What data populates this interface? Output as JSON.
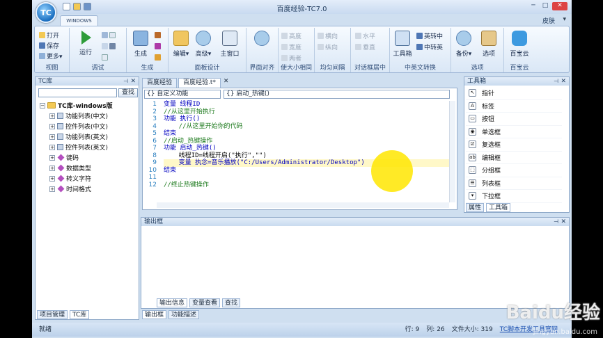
{
  "window": {
    "title": "百度经验-TC7.0",
    "skin_label": "皮肤",
    "skin_arrow": "▾"
  },
  "ribbon": {
    "tab": "WINDOWS",
    "groups": {
      "view": {
        "label": "视图",
        "open": "打开",
        "save": "保存",
        "more": "更多"
      },
      "debug": {
        "label": "调试",
        "run": "运行"
      },
      "build": {
        "label": "生成",
        "build": "生成"
      },
      "panel": {
        "label": "面板设计",
        "edit": "编辑",
        "advanced": "高级",
        "main_window": "主窗口"
      },
      "ui_align": {
        "label": "界面对齐",
        "button": "界面对齐"
      },
      "size": {
        "label": "使大小相同",
        "height": "高度",
        "width": "宽度",
        "both": "两者"
      },
      "spacing": {
        "label": "均匀间隔",
        "horizontal": "横向",
        "vertical": "纵向"
      },
      "center": {
        "label": "对话框居中",
        "horizontal": "水平",
        "vertical": "垂直"
      },
      "cn_en": {
        "label": "中英文转换",
        "toolbox": "工具箱",
        "en_to_cn": "英转中",
        "cn_to_en": "中转英"
      },
      "options": {
        "label": "选项",
        "backup": "备份",
        "options": "选项"
      },
      "baidu": {
        "label": "百宝云",
        "button": "百宝云"
      }
    }
  },
  "left_panel": {
    "title": "TC库",
    "search_button": "查找",
    "tree": [
      {
        "label": "TC库-windows版",
        "kind": "root"
      },
      {
        "label": "功能列表(中文)",
        "kind": "grid"
      },
      {
        "label": "控件列表(中文)",
        "kind": "grid"
      },
      {
        "label": "功能列表(英文)",
        "kind": "grid"
      },
      {
        "label": "控件列表(英文)",
        "kind": "grid"
      },
      {
        "label": "键码",
        "kind": "diamond"
      },
      {
        "label": "数据类型",
        "kind": "diamond"
      },
      {
        "label": "转义字符",
        "kind": "diamond"
      },
      {
        "label": "时间格式",
        "kind": "diamond"
      }
    ],
    "bottom_tabs": [
      "项目管理",
      "TC库"
    ]
  },
  "editor": {
    "tabs": [
      "百度经验",
      "百度经验.t*"
    ],
    "combo_left": "{} 自定义功能",
    "combo_right": "{} 启动_热键()",
    "line_numbers": [
      "1",
      "2",
      "3",
      "4",
      "5",
      "6",
      "7",
      "8",
      "9",
      "10",
      "11",
      "12"
    ],
    "lines": [
      "变量 线程ID",
      "//从这里开始执行",
      "功能 执行()",
      "    //从这里开始你的代码",
      "结束",
      "//启动_热键操作",
      "功能 启动_热键()",
      "    线程ID=线程开启(\"执行\",\"\")",
      "    变量 执念=音乐播放(\"C:/Users/Administrator/Desktop\")",
      "结束",
      "",
      "//终止热键操作"
    ]
  },
  "toolbox": {
    "title": "工具箱",
    "items": [
      "指针",
      "标签",
      "按钮",
      "单选框",
      "复选框",
      "编辑框",
      "分组框",
      "列表框",
      "下拉框"
    ],
    "bottom_tabs": [
      "属性",
      "工具箱"
    ]
  },
  "output": {
    "title": "输出框",
    "tabs": [
      "输出信息",
      "变量查看",
      "查找"
    ],
    "bottom_tabs": [
      "输出框",
      "功能描述"
    ]
  },
  "status": {
    "left": "就绪",
    "line": "行: 9",
    "col": "列: 26",
    "filesize": "文件大小: 319",
    "link": "TC脚本开发工具官网"
  },
  "watermark": {
    "brand": "Baidu经验",
    "url": "jingyan.baidu.com"
  }
}
